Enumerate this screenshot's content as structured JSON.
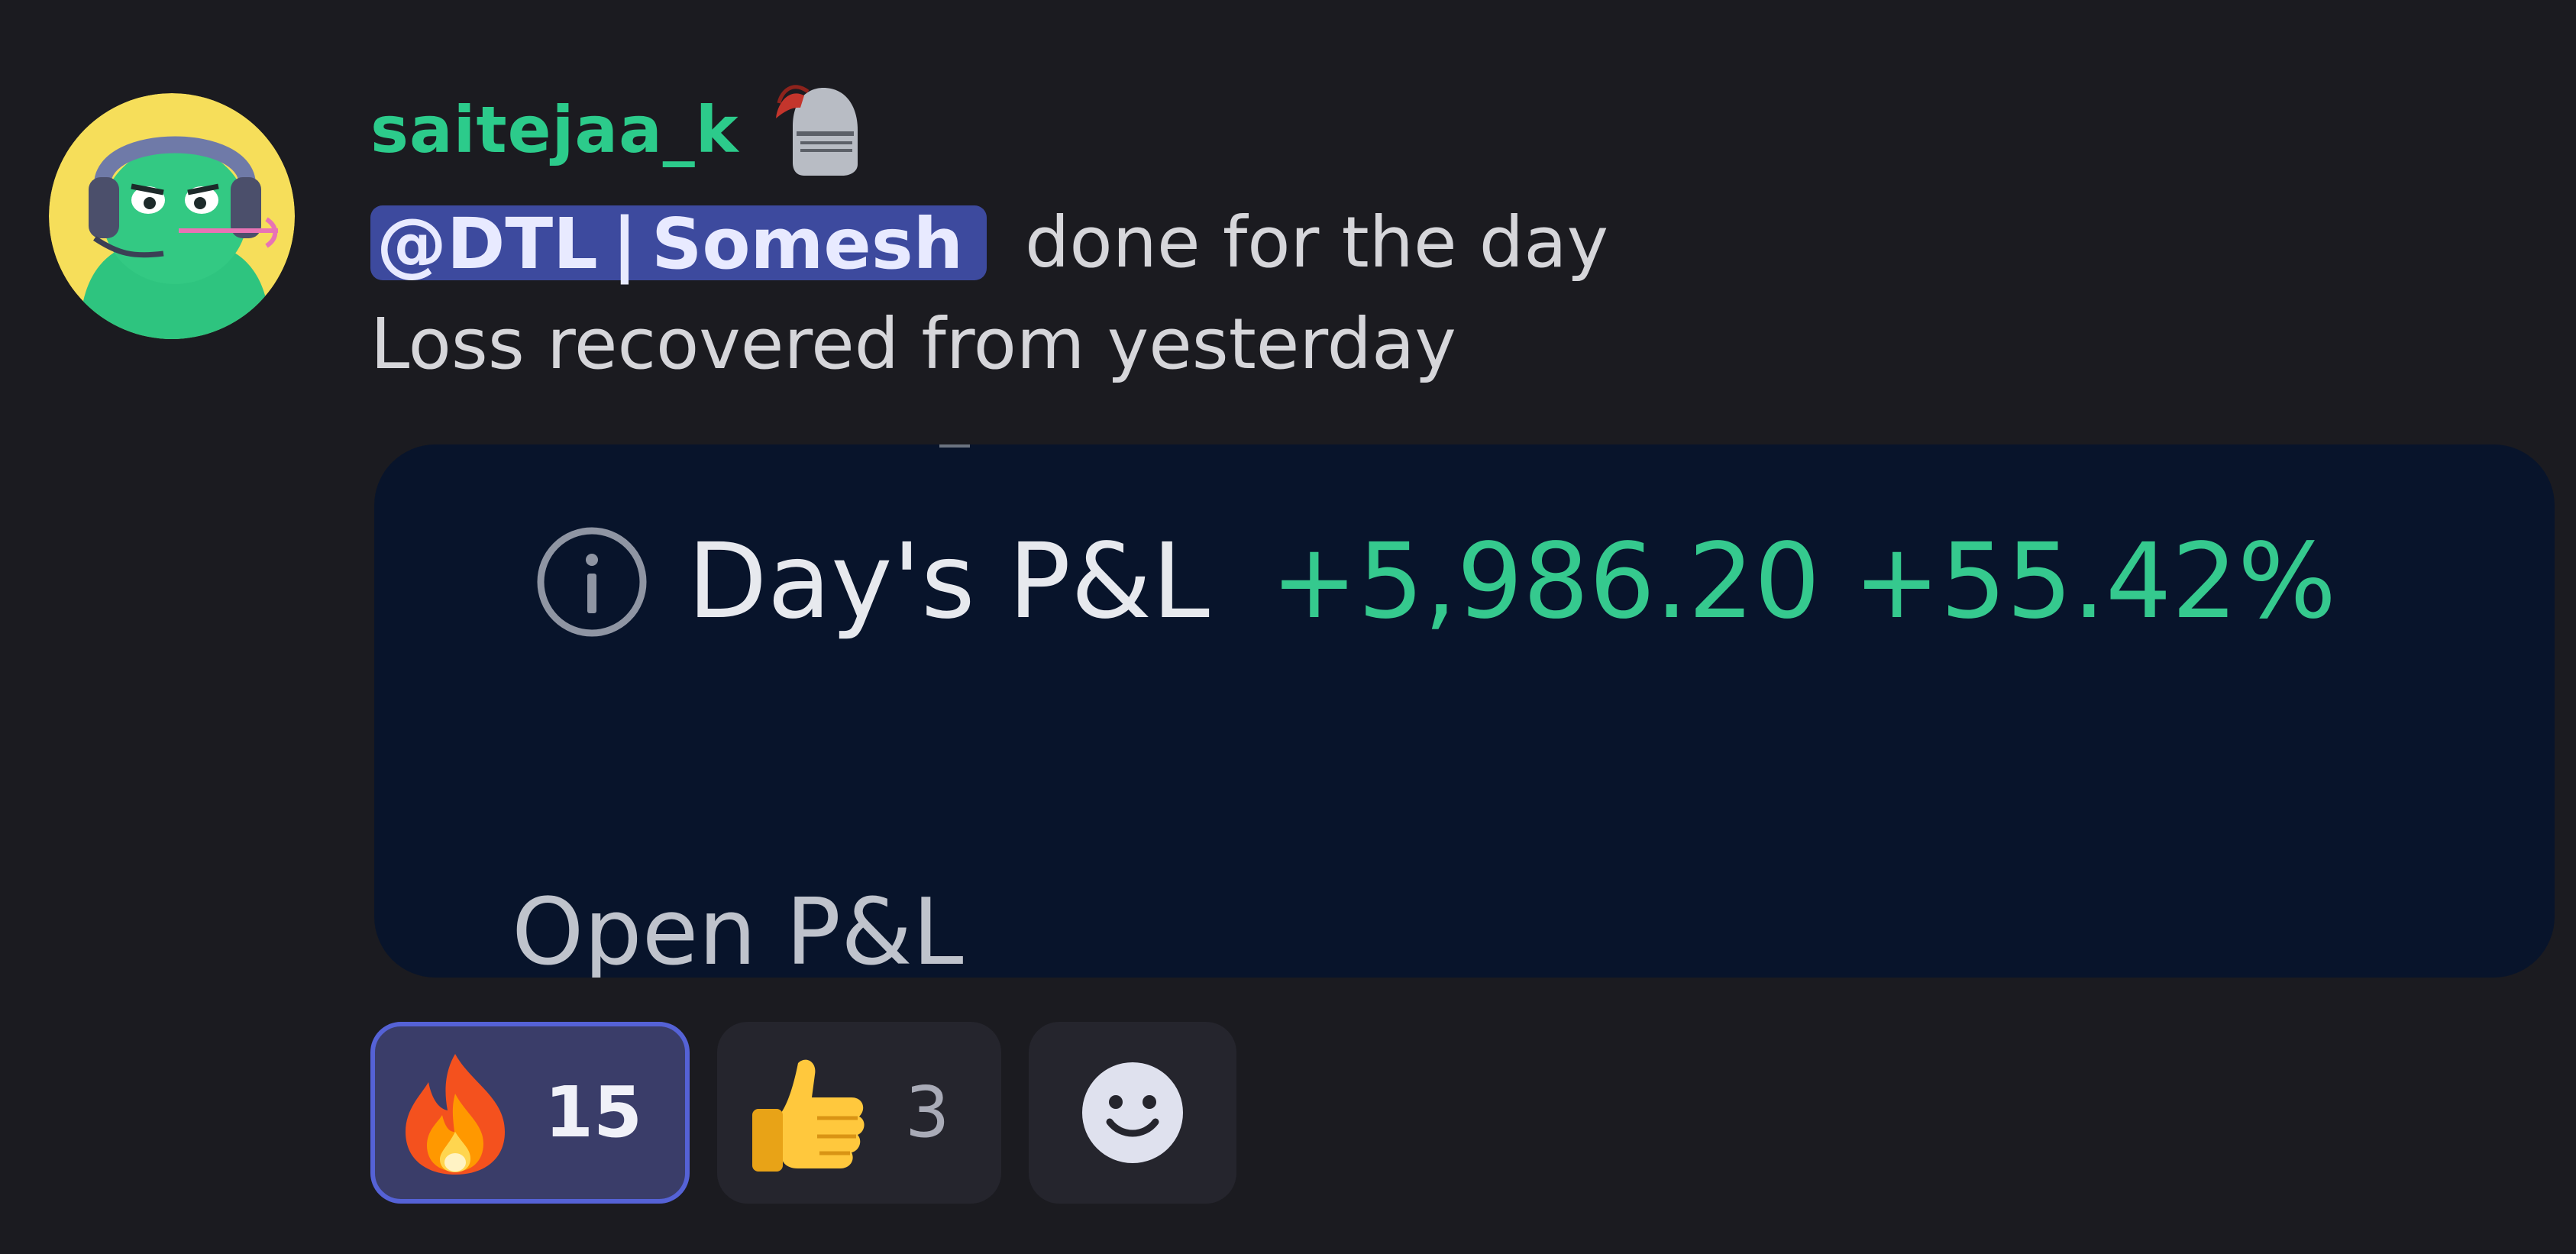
{
  "message": {
    "author": {
      "username": "saitejaa_k"
    },
    "mention": "@DTL | Somesh",
    "line1_text": "done for the day",
    "line2_text": "Loss recovered from yesterday"
  },
  "attachment": {
    "pnl_label": "Day's P&L",
    "pnl_value": "+5,986.20 +55.42%",
    "open_pnl_label": "Open P&L"
  },
  "reactions": [
    {
      "emoji": "fire",
      "count": "15",
      "active": true
    },
    {
      "emoji": "thumbs-up",
      "count": "3",
      "active": false
    }
  ],
  "colors": {
    "background": "#1b1b20",
    "username": "#2ccb8b",
    "mention_bg": "#3d4a9e",
    "attachment_bg": "#08142b",
    "pnl_positive": "#35c98e",
    "reaction_active_border": "#5562d6"
  }
}
